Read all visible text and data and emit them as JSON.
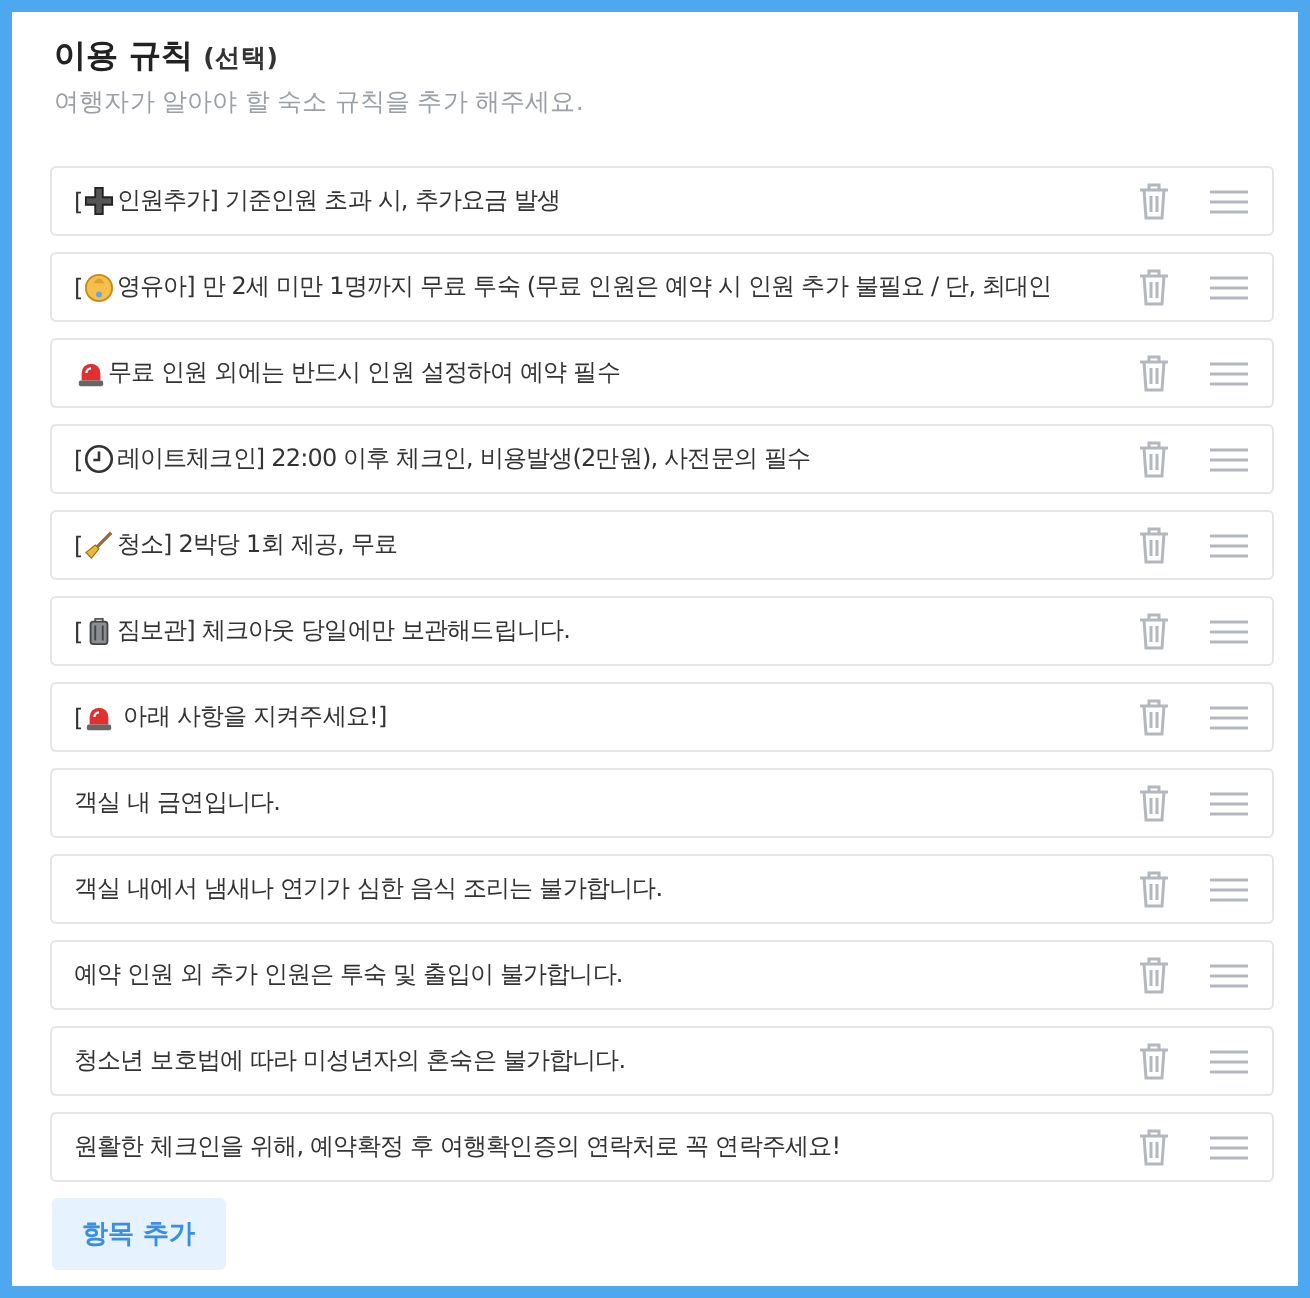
{
  "header": {
    "title": "이용 규칙",
    "title_note": "(선택)",
    "subtitle": "여행자가 알아야 할 숙소 규칙을 추가 해주세요."
  },
  "rules": [
    {
      "prefix": "[",
      "kind": "plus",
      "text": "인원추가] 기준인원 초과 시, 추가요금 발생"
    },
    {
      "prefix": "[",
      "kind": "baby",
      "text": "영유아] 만 2세 미만 1명까지 무료 투숙 (무료 인원은 예약 시 인원 추가 불필요 / 단, 최대인"
    },
    {
      "kind": "siren",
      "text": "무료 인원 외에는 반드시 인원 설정하여 예약 필수"
    },
    {
      "prefix": "[",
      "kind": "clock",
      "text": "레이트체크인] 22:00 이후 체크인, 비용발생(2만원), 사전문의 필수"
    },
    {
      "prefix": "[",
      "kind": "broom",
      "text": "청소] 2박당 1회 제공, 무료"
    },
    {
      "prefix": "[",
      "kind": "luggage",
      "text": "짐보관] 체크아웃 당일에만 보관해드립니다."
    },
    {
      "prefix": "[",
      "kind": "siren",
      "text": " 아래 사항을 지켜주세요!]"
    },
    {
      "text": "객실 내 금연입니다."
    },
    {
      "text": "객실 내에서 냄새나 연기가 심한 음식 조리는 불가합니다."
    },
    {
      "text": "예약 인원 외 추가 인원은 투숙 및 출입이 불가합니다."
    },
    {
      "text": "청소년 보호법에 따라 미성년자의 혼숙은 불가합니다."
    },
    {
      "text": "원활한 체크인을 위해, 예약확정 후 여행확인증의 연락처로 꼭 연락주세요!"
    }
  ],
  "add_button": "항목 추가"
}
